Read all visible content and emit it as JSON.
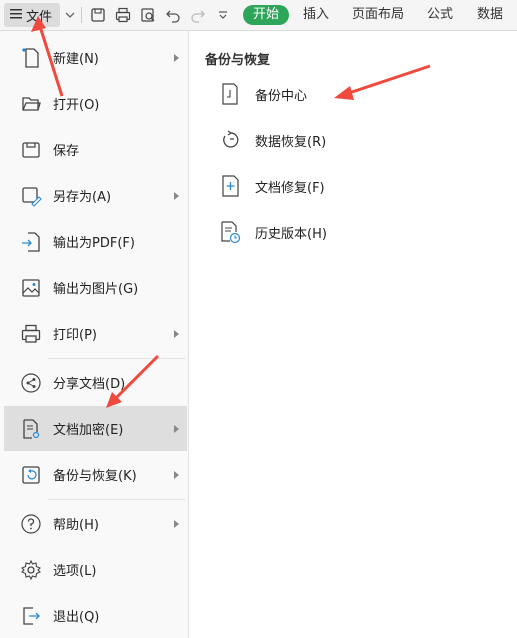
{
  "toolbar": {
    "file_label": "文件",
    "tabs": [
      {
        "label": "开始"
      },
      {
        "label": "插入"
      },
      {
        "label": "页面布局"
      },
      {
        "label": "公式"
      },
      {
        "label": "数据"
      }
    ]
  },
  "menu": {
    "items": [
      {
        "label": "新建(N)",
        "icon": "new-file-icon",
        "has_submenu": true
      },
      {
        "label": "打开(O)",
        "icon": "folder-open-icon",
        "has_submenu": false
      },
      {
        "label": "保存",
        "icon": "save-icon",
        "has_submenu": false
      },
      {
        "label": "另存为(A)",
        "icon": "save-as-icon",
        "has_submenu": true
      },
      {
        "label": "输出为PDF(F)",
        "icon": "export-pdf-icon",
        "has_submenu": false
      },
      {
        "label": "输出为图片(G)",
        "icon": "export-image-icon",
        "has_submenu": false
      },
      {
        "label": "打印(P)",
        "icon": "printer-icon",
        "has_submenu": true
      },
      {
        "label": "分享文档(D)",
        "icon": "share-icon",
        "has_submenu": false
      },
      {
        "label": "文档加密(E)",
        "icon": "encrypt-doc-icon",
        "has_submenu": true,
        "highlighted": true
      },
      {
        "label": "备份与恢复(K)",
        "icon": "backup-restore-icon",
        "has_submenu": true
      },
      {
        "label": "帮助(H)",
        "icon": "help-icon",
        "has_submenu": true
      },
      {
        "label": "选项(L)",
        "icon": "gear-icon",
        "has_submenu": false
      },
      {
        "label": "退出(Q)",
        "icon": "exit-icon",
        "has_submenu": false
      }
    ]
  },
  "panel": {
    "title": "备份与恢复",
    "items": [
      {
        "label": "备份中心",
        "icon": "backup-center-icon"
      },
      {
        "label": "数据恢复(R)",
        "icon": "data-recovery-icon"
      },
      {
        "label": "文档修复(F)",
        "icon": "doc-repair-icon"
      },
      {
        "label": "历史版本(H)",
        "icon": "history-version-icon"
      }
    ]
  },
  "colors": {
    "accent": "#2fa55a",
    "annotation_arrow": "#f04a3e",
    "highlight_bg": "#dedede"
  }
}
